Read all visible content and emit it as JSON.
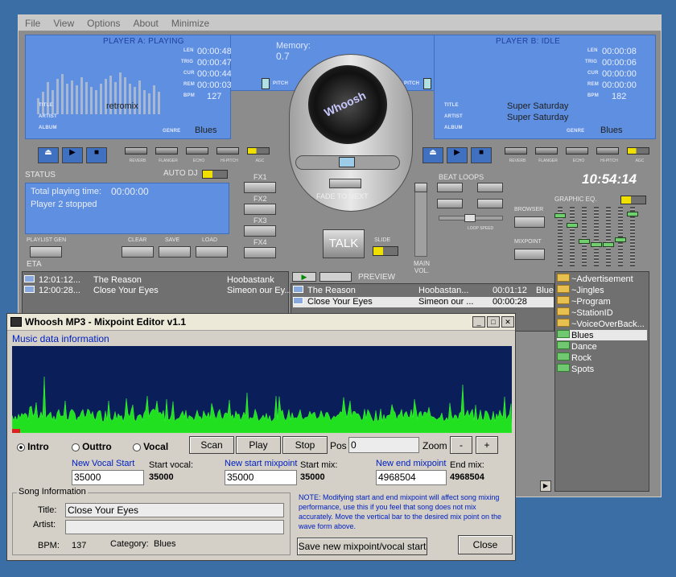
{
  "menu": [
    "File",
    "View",
    "Options",
    "About",
    "Minimize"
  ],
  "playerA": {
    "header": "PLAYER A: PLAYING",
    "len": "00:00:48",
    "trig": "00:00:47",
    "cur": "00:00:44",
    "rem": "00:00:03",
    "bpm": "127",
    "title": "retromix",
    "artist": "",
    "album": "",
    "genre": "Blues"
  },
  "playerB": {
    "header": "PLAYER B: IDLE",
    "len": "00:00:08",
    "trig": "00:00:06",
    "cur": "00:00:00",
    "rem": "00:00:00",
    "bpm": "182",
    "title": "Super Saturday",
    "artist": "Super Saturday",
    "album": "",
    "genre": "Blues"
  },
  "labels": {
    "len": "LEN",
    "trig": "TRIG",
    "cur": "CUR",
    "rem": "REM",
    "bpm": "BPM",
    "title": "TITLE",
    "artist": "ARTIST",
    "album": "ALBUM",
    "genre": "GENRE",
    "pitch": "PITCH"
  },
  "memory": {
    "label": "Memory:",
    "value": "0.7"
  },
  "logo_text": "Whoosh",
  "fx": [
    "REVERB",
    "FLANGER",
    "ECHO",
    "HI-PITCH",
    "AGC"
  ],
  "status": {
    "label": "STATUS",
    "autodj": "AUTO DJ",
    "line1_label": "Total playing time:",
    "line1_value": "00:00:00",
    "line2": "Player 2 stopped"
  },
  "fxButtons": [
    "FX1",
    "FX2",
    "FX3",
    "FX4"
  ],
  "bottomButtons": {
    "playlistgen": "PLAYLIST GEN",
    "clear": "CLEAR",
    "save": "SAVE",
    "load": "LOAD"
  },
  "center": {
    "fade": "FADE TO NEXT",
    "talk": "TALK",
    "slide": "SLIDE",
    "mainvol": "MAIN VOL.",
    "preview": "PREVIEW"
  },
  "beat": {
    "label": "BEAT LOOPS",
    "loopspeed": "LOOP SPEED"
  },
  "clock": "10:54:14",
  "graphiceq": "GRAPHIC EQ.",
  "sideButtons": {
    "browser": "BROWSER",
    "mixpoint": "MIXPOINT"
  },
  "eta": "ETA",
  "queue": [
    {
      "time": "12:01:12...",
      "title": "The Reason",
      "artist": "Hoobastank"
    },
    {
      "time": "12:00:28...",
      "title": "Close Your Eyes",
      "artist": "Simeon our Ey..."
    }
  ],
  "preview_list": [
    {
      "title": "The Reason",
      "artist": "Hoobastan...",
      "time": "00:01:12",
      "genre": "Blue"
    },
    {
      "title": "Close Your Eyes",
      "artist": "Simeon our ...",
      "time": "00:00:28",
      "genre": ""
    }
  ],
  "folders": [
    "~Advertisement",
    "~Jingles",
    "~Program",
    "~StationID",
    "~VoiceOverBack..."
  ],
  "categories": [
    "Blues",
    "Dance",
    "Rock",
    "Spots"
  ],
  "dialog": {
    "title": "Whoosh MP3 - Mixpoint Editor v1.1",
    "music_info": "Music data information",
    "radios": [
      "Intro",
      "Outtro",
      "Vocal"
    ],
    "scan": "Scan",
    "play": "Play",
    "stop": "Stop",
    "pos_label": "Pos",
    "pos_value": "0",
    "zoom_label": "Zoom",
    "zoom_minus": "-",
    "zoom_plus": "+",
    "new_vocal_start": "New Vocal Start",
    "vocal_value": "35000",
    "start_vocal_label": "Start vocal:",
    "start_vocal_value": "35000",
    "new_start_mix": "New start mixpoint",
    "start_mix_value": "35000",
    "start_mix_label": "Start mix:",
    "start_mix_display": "35000",
    "new_end_mix": "New end mixpoint",
    "end_mix_value": "4968504",
    "end_mix_label": "End mix:",
    "end_mix_display": "4968504",
    "song_info": "Song Information",
    "title_label": "Title:",
    "title_value": "Close Your Eyes",
    "artist_label": "Artist:",
    "artist_value": "",
    "bpm_label": "BPM:",
    "bpm_value": "137",
    "category_label": "Category:",
    "category_value": "Blues",
    "note": "NOTE: Modifying start and end mixpoint will affect song mixing performance, use this if you feel that song does not mix accurately. Move the vertical bar to the desired mix point on the wave form above.",
    "save_btn": "Save new mixpoint/vocal start",
    "close_btn": "Close"
  }
}
